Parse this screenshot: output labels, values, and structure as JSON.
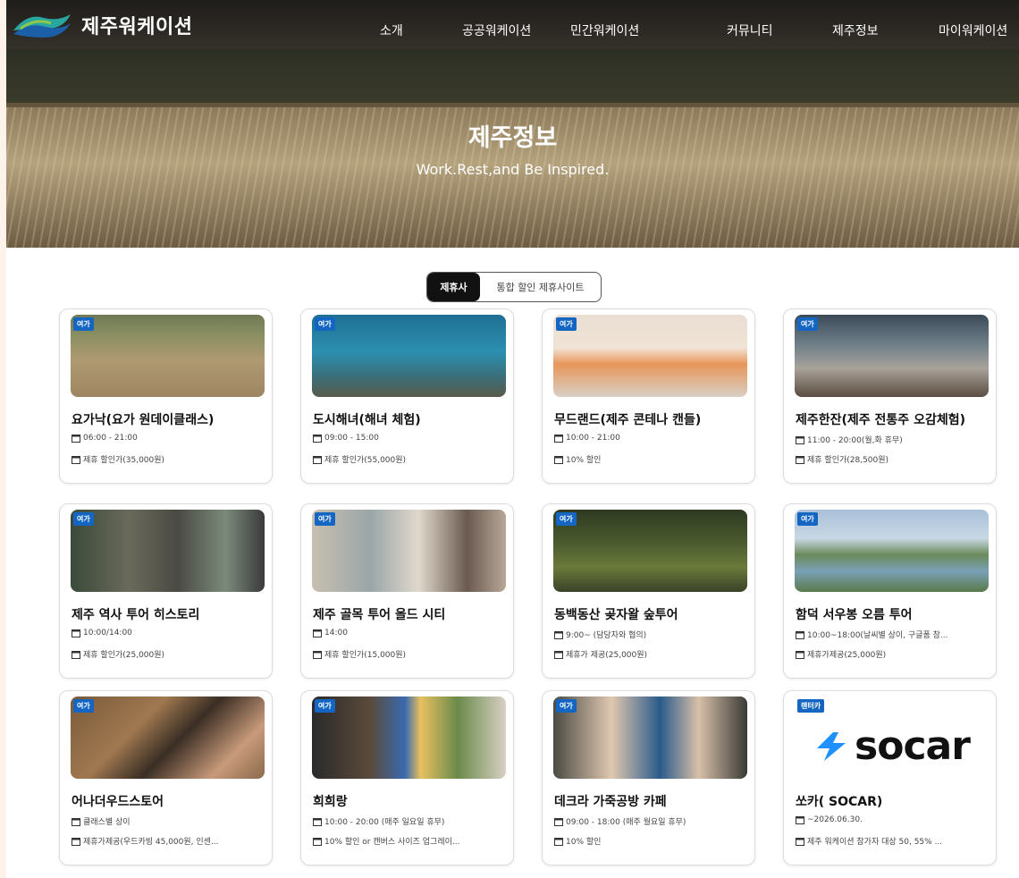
{
  "site": {
    "name": "제주워케이션"
  },
  "nav": {
    "items": [
      "소개",
      "공공워케이션",
      "민간워케이션",
      "커뮤니티",
      "제주정보",
      "마이워케이션"
    ]
  },
  "hero": {
    "title": "제주정보",
    "subtitle": "Work.Rest,and Be Inspired."
  },
  "tabs": {
    "active": "제휴사",
    "inactive": "통합 할인 제휴사이트"
  },
  "cards": [
    {
      "badge": "여가",
      "title": "요가낙(요가 원데이클래스)",
      "line1": "06:00 - 21:00",
      "line2": "제휴 할인가(35,000원)"
    },
    {
      "badge": "여가",
      "title": "도시해녀(해녀 체험)",
      "line1": "09:00 - 15:00",
      "line2": "제휴 할인가(55,000원)"
    },
    {
      "badge": "여가",
      "title": "무드랜드(제주 콘테나 캔들)",
      "line1": "10:00 - 21:00",
      "line2": "10% 할인"
    },
    {
      "badge": "여가",
      "title": "제주한잔(제주 전통주 오감체험)",
      "line1": "11:00 - 20:00(월,화 휴무)",
      "line2": "제휴 할인가(28,500원)"
    },
    {
      "badge": "여가",
      "title": "제주 역사 투어 히스토리",
      "line1": "10:00/14:00",
      "line2": "제휴 할인가(25,000원)"
    },
    {
      "badge": "여가",
      "title": "제주 골목 투어 올드 시티",
      "line1": "14:00",
      "line2": "제휴 할인가(15,000원)"
    },
    {
      "badge": "여가",
      "title": "동백동산 곶자왈 숲투어",
      "line1": "9:00~ (담당자와 협의)",
      "line2": "제휴가 제공(25,000원)"
    },
    {
      "badge": "여가",
      "title": "함덕 서우봉 오름 투어",
      "line1": "10:00~18:00(날씨별 상이, 구글폼 참...",
      "line2": "제휴가제공(25,000원)"
    },
    {
      "badge": "여가",
      "title": "어나더우드스토어",
      "line1": "클래스별 상이",
      "line2": "제휴가제공(우드카빙 45,000원, 인센...",
      "thumb_kind": "wood"
    },
    {
      "badge": "여가",
      "title": "희희랑",
      "line1": "10:00 - 20:00 (매주 일요일 휴무)",
      "line2": "10% 할인 or 캔버스 사이즈 업그레이...",
      "thumb_kind": "paint"
    },
    {
      "badge": "여가",
      "title": "데크라 가죽공방 카페",
      "line1": "09:00 - 18:00 (매주 월요일 휴무)",
      "line2": "10% 할인",
      "thumb_kind": "leather"
    },
    {
      "badge": "렌터카",
      "title": "쏘카( SOCAR)",
      "line1": "~2026.06.30.",
      "line2": "제주 워케이션 참가자 대상 50, 55% ...",
      "logo_text": "socar"
    }
  ],
  "colors": {
    "badge": "#1466c2",
    "active_tab": "#111111"
  }
}
